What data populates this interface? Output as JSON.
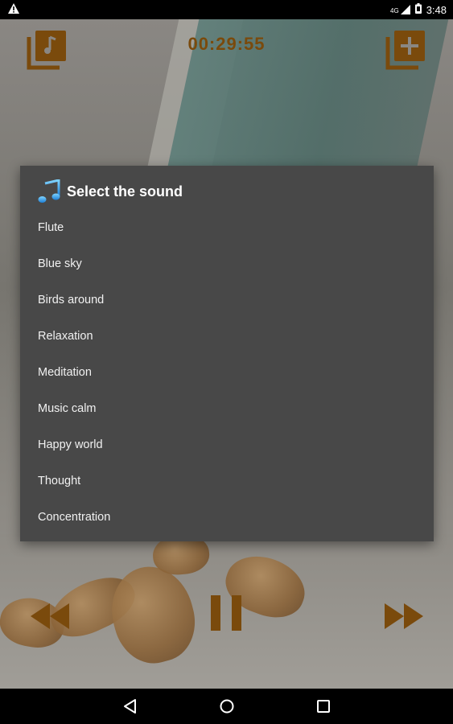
{
  "status_bar": {
    "network_label": "4G",
    "time": "3:48"
  },
  "player": {
    "timer": "00:29:55"
  },
  "dialog": {
    "title": "Select the sound",
    "sounds": [
      "Flute",
      "Blue sky",
      "Birds around",
      "Relaxation",
      "Meditation",
      "Music calm",
      "Happy world",
      "Thought",
      "Concentration"
    ]
  },
  "icons": {
    "music_library": "music-library-icon",
    "add_sound": "add-sound-icon",
    "rewind": "rewind-icon",
    "pause": "pause-icon",
    "forward": "fast-forward-icon",
    "dialog_title": "music-note-icon"
  },
  "colors": {
    "accent": "#7a4a0c",
    "dialog_bg": "#484848",
    "dialog_text": "#f1f1f1"
  }
}
